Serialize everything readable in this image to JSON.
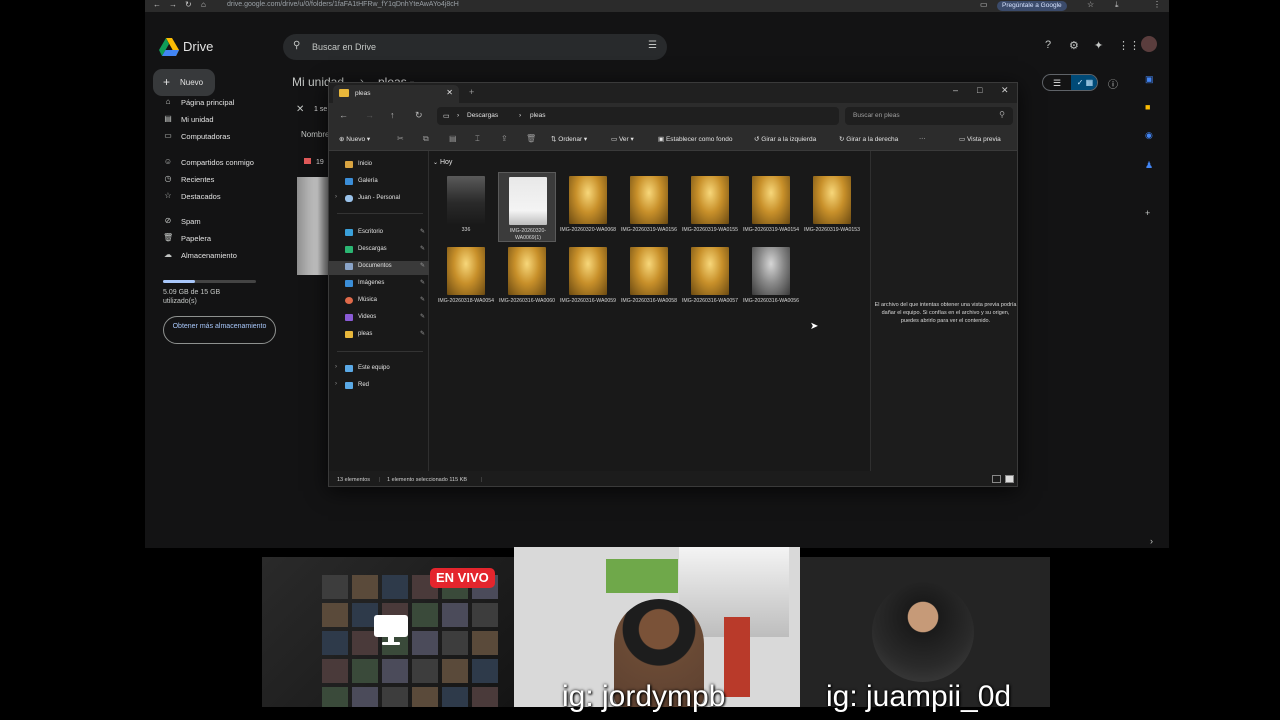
{
  "browser": {
    "url": "drive.google.com/drive/u/0/folders/1faFA1tHFRw_fY1qDnhYteAwAYo4j8cH",
    "ask_button": "Pregúntale a Google"
  },
  "drive": {
    "app_name": "Drive",
    "search_placeholder": "Buscar en Drive",
    "new_button": "Nuevo",
    "sidebar": [
      {
        "label": "Página principal",
        "icon": "home-icon"
      },
      {
        "label": "Mi unidad",
        "icon": "drive-icon"
      },
      {
        "label": "Computadoras",
        "icon": "computer-icon"
      },
      {
        "label": "Compartidos conmigo",
        "icon": "people-icon"
      },
      {
        "label": "Recientes",
        "icon": "clock-icon"
      },
      {
        "label": "Destacados",
        "icon": "star-icon"
      },
      {
        "label": "Spam",
        "icon": "spam-icon"
      },
      {
        "label": "Papelera",
        "icon": "trash-icon"
      },
      {
        "label": "Almacenamiento",
        "icon": "cloud-icon"
      }
    ],
    "storage_text": "5.09 GB de 15 GB utilizado(s)",
    "storage_fraction": 0.34,
    "get_more": "Obtener más almacenamiento",
    "breadcrumb_root": "Mi unidad",
    "breadcrumb_sep": "›",
    "breadcrumb_current": "pleas",
    "selected_count": "1 se",
    "column_name": "Nombre",
    "row_peek": "19"
  },
  "explorer": {
    "tab_title": "pleas",
    "path": [
      "Descargas",
      "pleas"
    ],
    "search_placeholder": "Buscar en pleas",
    "toolbar": {
      "new": "Nuevo",
      "sort": "Ordenar",
      "view": "Ver",
      "set_background": "Establecer como fondo",
      "rotate_left": "Girar a la izquierda",
      "rotate_right": "Girar a la derecha",
      "more": "···",
      "preview_pane": "Vista previa"
    },
    "nav": {
      "home": "Inicio",
      "gallery": "Galería",
      "onedrive": "Juan - Personal",
      "desktop": "Escritorio",
      "downloads": "Descargas",
      "documents": "Documentos",
      "pictures": "Imágenes",
      "music": "Música",
      "videos": "Videos",
      "pleas": "pleas",
      "this_pc": "Este equipo",
      "network": "Red"
    },
    "group_label": "Hoy",
    "files": [
      {
        "name": "336",
        "thumb": "photo"
      },
      {
        "name": "IMG-20260320-WA0069(1)",
        "thumb": "whitebox"
      },
      {
        "name": "IMG-20260320-WA0068",
        "thumb": "card"
      },
      {
        "name": "IMG-20260319-WA0156",
        "thumb": "card"
      },
      {
        "name": "IMG-20260319-WA0155",
        "thumb": "card"
      },
      {
        "name": "IMG-20260319-WA0154",
        "thumb": "card"
      },
      {
        "name": "IMG-20260319-WA0153",
        "thumb": "card"
      },
      {
        "name": "IMG-20260318-WA0054",
        "thumb": "card"
      },
      {
        "name": "IMG-20260316-WA0060",
        "thumb": "card"
      },
      {
        "name": "IMG-20260316-WA0059",
        "thumb": "card"
      },
      {
        "name": "IMG-20260316-WA0058",
        "thumb": "card"
      },
      {
        "name": "IMG-20260316-WA0057",
        "thumb": "card"
      },
      {
        "name": "IMG-20260316-WA0056",
        "thumb": "card2"
      }
    ],
    "preview_message": "El archivo del que intentas obtener una vista previa podría dañar el equipo. Si confías en el archivo y su origen, puedes abrirlo para ver el contenido.",
    "status_items": "13 elementos",
    "status_selected": "1 elemento seleccionado  115 KB"
  },
  "stream": {
    "live_badge": "EN VIVO",
    "handle_center": "ig: jordympb",
    "handle_right": "ig: juampii_0d"
  }
}
